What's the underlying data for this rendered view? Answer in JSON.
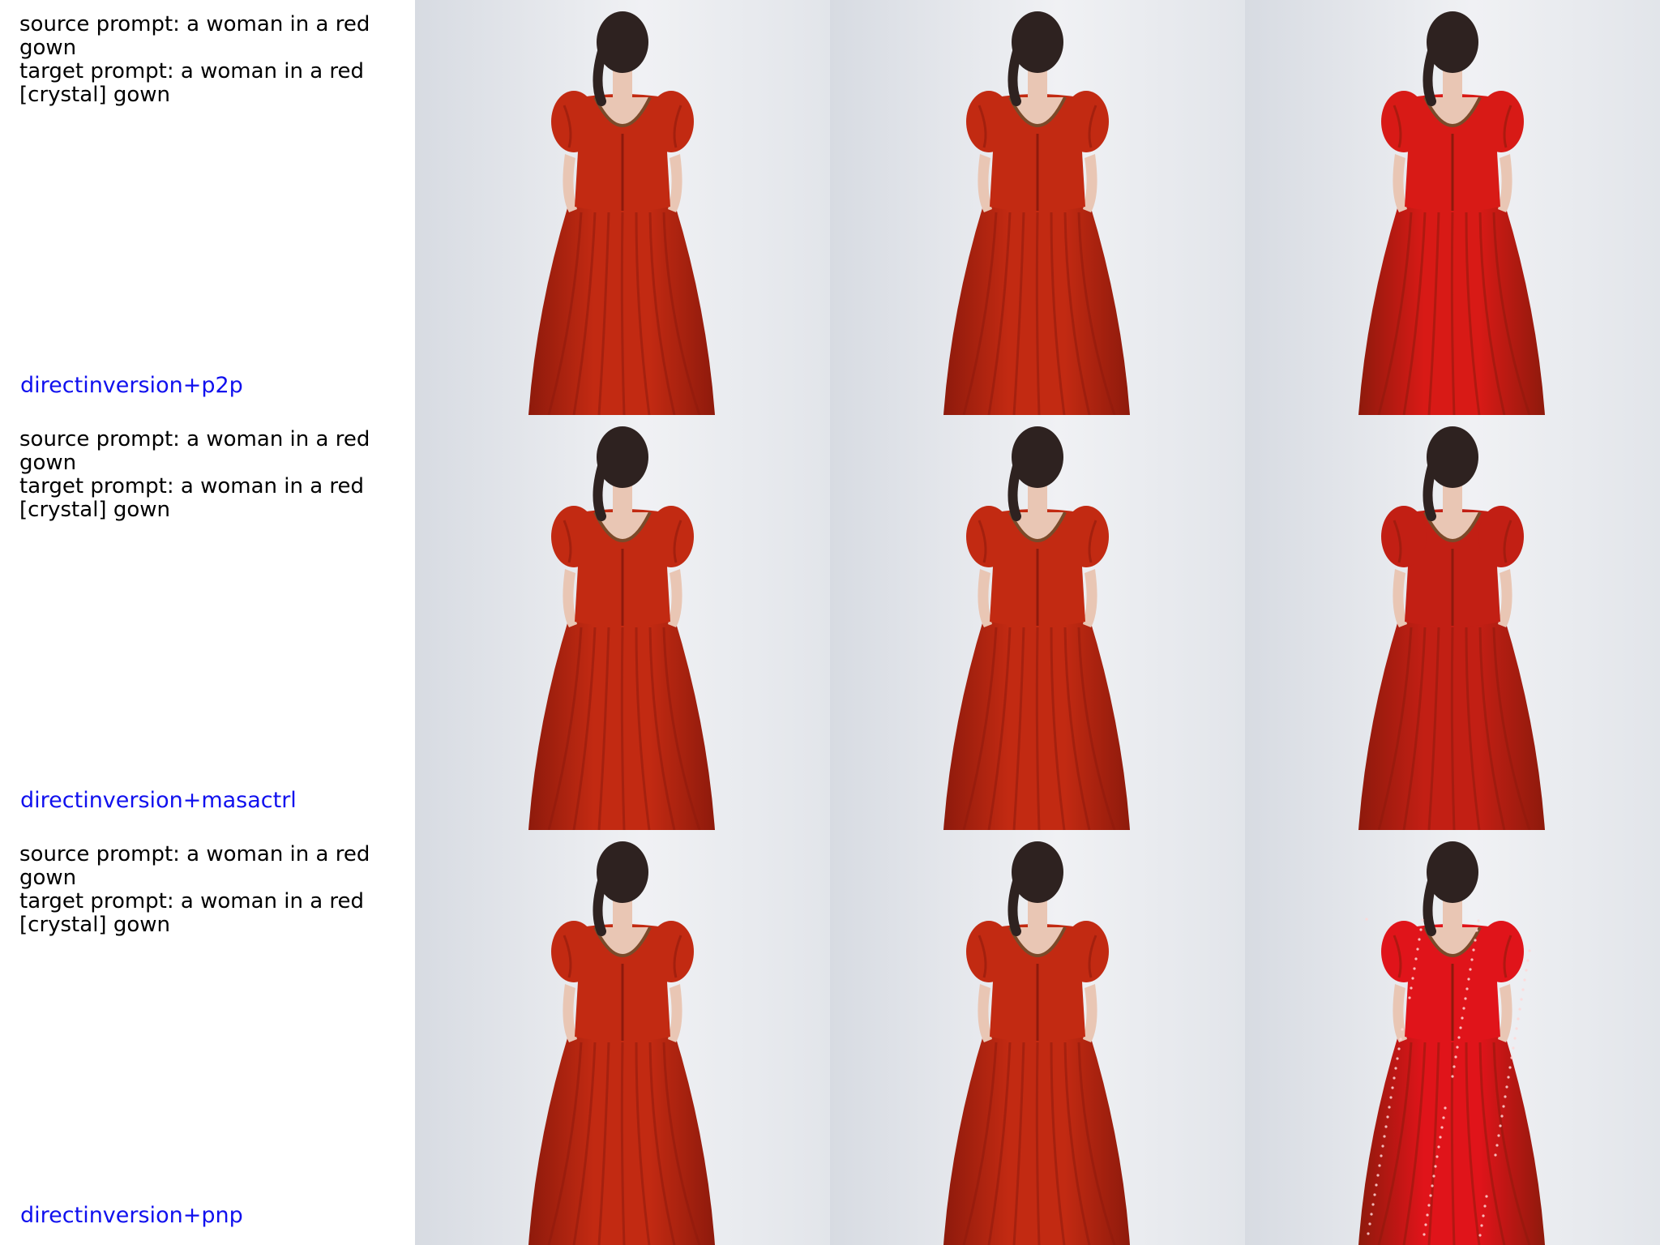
{
  "rows": [
    {
      "source_prompt": "source prompt: a woman in a red gown",
      "target_prompt": "target prompt: a woman in a red [crystal] gown",
      "method": "directinversion+p2p",
      "edited_color": "#d81a16",
      "edited_sparkle": false
    },
    {
      "source_prompt": "source prompt: a woman in a red gown",
      "target_prompt": "target prompt: a woman in a red [crystal] gown",
      "method": "directinversion+masactrl",
      "edited_color": "#c21f14",
      "edited_sparkle": false
    },
    {
      "source_prompt": "source prompt: a woman in a red gown",
      "target_prompt": "target prompt: a woman in a red [crystal] gown",
      "method": "directinversion+pnp",
      "edited_color": "#e0141a",
      "edited_sparkle": true
    }
  ],
  "colors": {
    "background_gray": "#e4e7ec",
    "gown_source": "#c22a12",
    "gown_shadow": "#8e1a0c",
    "hair": "#2e2220",
    "skin": "#e9c6b4"
  }
}
